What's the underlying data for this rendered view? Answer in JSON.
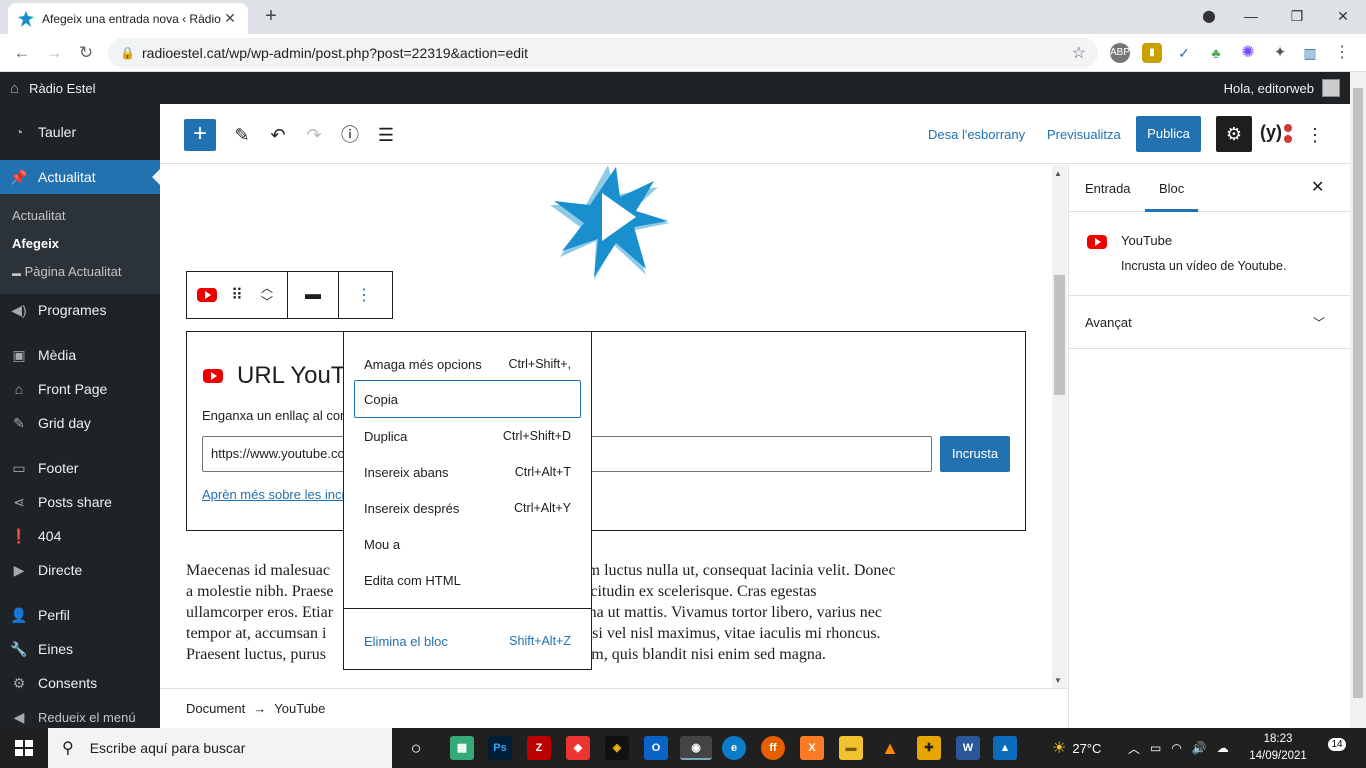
{
  "browser": {
    "tab_title": "Afegeix una entrada nova ‹ Ràdio",
    "tab_close": "✕",
    "new_tab": "+",
    "url": "radioestel.cat/wp/wp-admin/post.php?post=22319&action=edit",
    "nav": {
      "back": "←",
      "forward": "→",
      "reload": "↻"
    },
    "window": {
      "minimize": "—",
      "maximize": "❐",
      "close": "✕"
    }
  },
  "adminbar": {
    "site_name": "Ràdio Estel",
    "howdy": "Hola, editorweb"
  },
  "sidebar": {
    "items": [
      {
        "label": "Tauler",
        "icon": "dashboard-icon"
      },
      {
        "label": "Actualitat",
        "icon": "pin-icon",
        "active": true
      },
      {
        "label": "Programes",
        "icon": "speaker-icon"
      },
      {
        "label": "Mèdia",
        "icon": "media-icon"
      },
      {
        "label": "Front Page",
        "icon": "home-icon"
      },
      {
        "label": "Grid day",
        "icon": "pin-icon"
      },
      {
        "label": "Footer",
        "icon": "footer-icon"
      },
      {
        "label": "Posts share",
        "icon": "share-icon"
      },
      {
        "label": "404",
        "icon": "alert-icon"
      },
      {
        "label": "Directe",
        "icon": "play-icon"
      },
      {
        "label": "Perfil",
        "icon": "user-icon"
      },
      {
        "label": "Eines",
        "icon": "wrench-icon"
      },
      {
        "label": "Consents",
        "icon": "consent-icon"
      },
      {
        "label": "Redueix el menú",
        "icon": "collapse-icon"
      }
    ],
    "submenu": [
      "Actualitat",
      "Afegeix",
      "Pàgina Actualitat"
    ]
  },
  "toolbar": {
    "save_draft": "Desa l'esborrany",
    "preview": "Previsualitza",
    "publish": "Publica"
  },
  "embed": {
    "title": "URL YouTu",
    "help": "Enganxa un enllaç al con",
    "input_value": "https://www.youtube.co",
    "embed_button": "Incrusta",
    "learn_more": "Aprèn més sobre les incr"
  },
  "paragraph": {
    "lines": [
      "Maecenas id malesuac                                          alla, elementum luctus nulla ut, consequat lacinia velit. Donec",
      "a molestie nibh. Praese                                       putate, nec sollicitudin ex scelerisque. Cras egestas",
      "ullamcorper eros. Etiar                                         tum vitae magna ut mattis. Vivamus tortor libero, varius nec",
      "tempor at, accumsan i                                          enean mollis nisi vel nisl maximus, vitae iaculis mi rhoncus.",
      "Praesent luctus, purus                                           nc aliquet ipsum, quis blandit nisi enim sed magna."
    ]
  },
  "menu": {
    "items": [
      {
        "label": "Amaga més opcions",
        "shortcut": "Ctrl+Shift+,"
      },
      {
        "label": "Copia",
        "shortcut": ""
      },
      {
        "label": "Duplica",
        "shortcut": "Ctrl+Shift+D"
      },
      {
        "label": "Insereix abans",
        "shortcut": "Ctrl+Alt+T"
      },
      {
        "label": "Insereix després",
        "shortcut": "Ctrl+Alt+Y"
      },
      {
        "label": "Mou a",
        "shortcut": ""
      },
      {
        "label": "Edita com HTML",
        "shortcut": ""
      },
      {
        "label": "Elimina el bloc",
        "shortcut": "Shift+Alt+Z"
      }
    ]
  },
  "footer": {
    "crumb1": "Document",
    "arrow": "→",
    "crumb2": "YouTube"
  },
  "panel": {
    "tab_post": "Entrada",
    "tab_block": "Bloc",
    "block_name": "YouTube",
    "block_desc": "Incrusta un vídeo de Youtube.",
    "advanced": "Avançat"
  },
  "taskbar": {
    "search_placeholder": "Escribe aquí para buscar",
    "temperature": "27°C",
    "time": "18:23",
    "date": "14/09/2021",
    "notifications": "14"
  },
  "colors": {
    "wp_blue": "#2271b1",
    "wp_dark": "#1d2327",
    "youtube_red": "#ee0000"
  }
}
